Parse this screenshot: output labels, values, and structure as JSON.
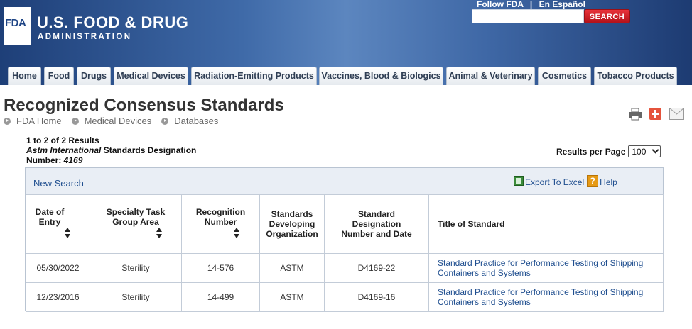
{
  "header": {
    "logo_mark": "FDA",
    "logo_title": "U.S. FOOD & DRUG",
    "logo_subtitle": "ADMINISTRATION",
    "follow_label": "Follow FDA",
    "espanol_label": "En Español",
    "separator": "|",
    "search_button_label": "SEARCH",
    "search_input_value": "",
    "search_input_placeholder": ""
  },
  "nav": {
    "tabs": [
      {
        "label": "Home"
      },
      {
        "label": "Food"
      },
      {
        "label": "Drugs"
      },
      {
        "label": "Medical Devices"
      },
      {
        "label": "Radiation-Emitting Products"
      },
      {
        "label": "Vaccines, Blood & Biologics"
      },
      {
        "label": "Animal & Veterinary"
      },
      {
        "label": "Cosmetics"
      },
      {
        "label": "Tobacco Products"
      }
    ]
  },
  "page": {
    "title": "Recognized Consensus Standards",
    "breadcrumb": [
      "FDA Home",
      "Medical Devices",
      "Databases"
    ],
    "tools": [
      "print-icon",
      "add-icon",
      "email-icon"
    ]
  },
  "results": {
    "count_text": "1 to 2 of 2 Results",
    "org_italic": "Astm International",
    "designation_text": " Standards Designation",
    "number_label": "Number: ",
    "number_value": "4169",
    "per_page_label": "Results per Page",
    "per_page_value": "100"
  },
  "box": {
    "new_search_label": "New Search",
    "export_label": "Export To Excel",
    "help_label": "Help",
    "help_glyph": "?"
  },
  "table": {
    "headers": [
      "Date of Entry",
      "Specialty Task Group Area",
      "Recognition Number",
      "Standards Developing Organization",
      "Standard Designation Number and Date",
      "Title of Standard"
    ],
    "rows": [
      {
        "date": "05/30/2022",
        "area": "Sterility",
        "recognition": "14-576",
        "org": "ASTM",
        "designation": "D4169-22",
        "title": "Standard Practice for Performance Testing of Shipping Containers and Systems"
      },
      {
        "date": "12/23/2016",
        "area": "Sterility",
        "recognition": "14-499",
        "org": "ASTM",
        "designation": "D4169-16",
        "title": "Standard Practice for Performance Testing of Shipping Containers and Systems"
      }
    ]
  },
  "colors": {
    "header_blue": "#1e3f78",
    "link_blue": "#1f4e8f",
    "search_red": "#d0202a"
  }
}
